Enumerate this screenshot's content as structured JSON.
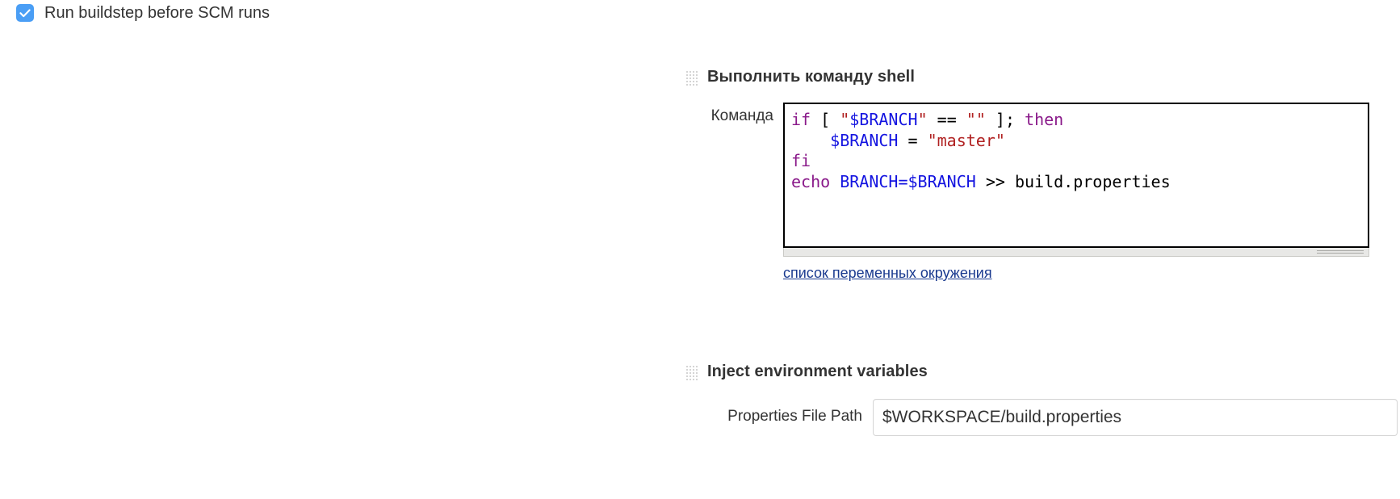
{
  "scm_option": {
    "label": "Run buildstep before SCM runs",
    "checked": true,
    "accent_color": "#4a9ef5"
  },
  "blocks": [
    {
      "title": "Выполнить команду shell",
      "field_label": "Команда",
      "command_lines": [
        [
          {
            "t": "if",
            "c": "kw"
          },
          {
            "t": " [ ",
            "c": "plain"
          },
          {
            "t": "\"",
            "c": "str"
          },
          {
            "t": "$BRANCH",
            "c": "var"
          },
          {
            "t": "\"",
            "c": "str"
          },
          {
            "t": " == ",
            "c": "plain"
          },
          {
            "t": "\"\"",
            "c": "str"
          },
          {
            "t": " ]; ",
            "c": "plain"
          },
          {
            "t": "then",
            "c": "kw"
          }
        ],
        [
          {
            "t": "    ",
            "c": "plain"
          },
          {
            "t": "$BRANCH",
            "c": "var"
          },
          {
            "t": " = ",
            "c": "plain"
          },
          {
            "t": "\"master\"",
            "c": "str"
          }
        ],
        [
          {
            "t": "fi",
            "c": "kw"
          }
        ],
        [
          {
            "t": "echo",
            "c": "kw"
          },
          {
            "t": " ",
            "c": "plain"
          },
          {
            "t": "BRANCH=$BRANCH",
            "c": "var"
          },
          {
            "t": " >> build.properties",
            "c": "plain"
          }
        ]
      ],
      "command_plaintext": "if [ \"$BRANCH\" == \"\" ]; then\n    $BRANCH = \"master\"\nfi\necho BRANCH=$BRANCH >> build.properties",
      "env_link": "список переменных окружения"
    },
    {
      "title": "Inject environment variables",
      "field_label": "Properties File Path",
      "properties_file_path": "$WORKSPACE/build.properties"
    }
  ]
}
